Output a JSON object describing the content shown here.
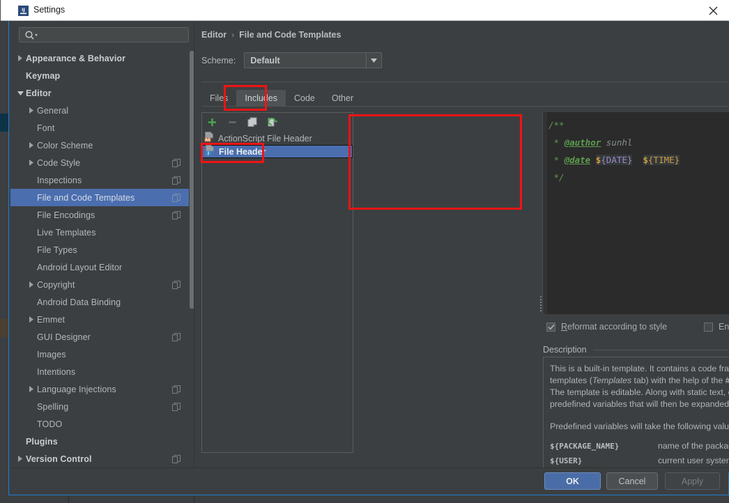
{
  "window": {
    "title": "Settings",
    "icon": "intellij-logo-icon",
    "close_label": "✕"
  },
  "sidebar": {
    "search": {
      "placeholder": "",
      "value": "",
      "icon": "search-icon"
    },
    "items": [
      {
        "label": "Appearance & Behavior",
        "arrow": "right",
        "indent": 0,
        "bold": true,
        "copy": false,
        "selected": false
      },
      {
        "label": "Keymap",
        "arrow": "none",
        "indent": 0,
        "bold": true,
        "copy": false,
        "selected": false
      },
      {
        "label": "Editor",
        "arrow": "down",
        "indent": 0,
        "bold": true,
        "copy": false,
        "selected": false
      },
      {
        "label": "General",
        "arrow": "right",
        "indent": 1,
        "bold": false,
        "copy": false,
        "selected": false
      },
      {
        "label": "Font",
        "arrow": "none",
        "indent": 1,
        "bold": false,
        "copy": false,
        "selected": false
      },
      {
        "label": "Color Scheme",
        "arrow": "right",
        "indent": 1,
        "bold": false,
        "copy": false,
        "selected": false
      },
      {
        "label": "Code Style",
        "arrow": "right",
        "indent": 1,
        "bold": false,
        "copy": true,
        "selected": false
      },
      {
        "label": "Inspections",
        "arrow": "none",
        "indent": 1,
        "bold": false,
        "copy": true,
        "selected": false
      },
      {
        "label": "File and Code Templates",
        "arrow": "none",
        "indent": 1,
        "bold": false,
        "copy": true,
        "selected": true
      },
      {
        "label": "File Encodings",
        "arrow": "none",
        "indent": 1,
        "bold": false,
        "copy": true,
        "selected": false
      },
      {
        "label": "Live Templates",
        "arrow": "none",
        "indent": 1,
        "bold": false,
        "copy": false,
        "selected": false
      },
      {
        "label": "File Types",
        "arrow": "none",
        "indent": 1,
        "bold": false,
        "copy": false,
        "selected": false
      },
      {
        "label": "Android Layout Editor",
        "arrow": "none",
        "indent": 1,
        "bold": false,
        "copy": false,
        "selected": false
      },
      {
        "label": "Copyright",
        "arrow": "right",
        "indent": 1,
        "bold": false,
        "copy": true,
        "selected": false
      },
      {
        "label": "Android Data Binding",
        "arrow": "none",
        "indent": 1,
        "bold": false,
        "copy": false,
        "selected": false
      },
      {
        "label": "Emmet",
        "arrow": "right",
        "indent": 1,
        "bold": false,
        "copy": false,
        "selected": false
      },
      {
        "label": "GUI Designer",
        "arrow": "none",
        "indent": 1,
        "bold": false,
        "copy": true,
        "selected": false
      },
      {
        "label": "Images",
        "arrow": "none",
        "indent": 1,
        "bold": false,
        "copy": false,
        "selected": false
      },
      {
        "label": "Intentions",
        "arrow": "none",
        "indent": 1,
        "bold": false,
        "copy": false,
        "selected": false
      },
      {
        "label": "Language Injections",
        "arrow": "right",
        "indent": 1,
        "bold": false,
        "copy": true,
        "selected": false
      },
      {
        "label": "Spelling",
        "arrow": "none",
        "indent": 1,
        "bold": false,
        "copy": true,
        "selected": false
      },
      {
        "label": "TODO",
        "arrow": "none",
        "indent": 1,
        "bold": false,
        "copy": false,
        "selected": false
      },
      {
        "label": "Plugins",
        "arrow": "none",
        "indent": 0,
        "bold": true,
        "copy": false,
        "selected": false
      },
      {
        "label": "Version Control",
        "arrow": "right",
        "indent": 0,
        "bold": true,
        "copy": true,
        "selected": false
      }
    ],
    "help_button": "?"
  },
  "breadcrumb": {
    "parent": "Editor",
    "separator": "›",
    "current": "File and Code Templates"
  },
  "scheme": {
    "label": "Scheme:",
    "value": "Default",
    "options": [
      "Default"
    ]
  },
  "tabs": [
    {
      "label": "Files",
      "active": false
    },
    {
      "label": "Includes",
      "active": true
    },
    {
      "label": "Code",
      "active": false
    },
    {
      "label": "Other",
      "active": false
    }
  ],
  "template_list": {
    "toolbar": [
      {
        "name": "add-template-button",
        "glyph": "+"
      },
      {
        "name": "remove-template-button",
        "glyph": "−"
      },
      {
        "name": "copy-template-button",
        "glyph": "copy"
      },
      {
        "name": "reset-template-button",
        "glyph": "reset"
      }
    ],
    "items": [
      {
        "label": "ActionScript File Header",
        "badge": "AS",
        "selected": false
      },
      {
        "label": "File Header",
        "badge": "J",
        "selected": true
      }
    ]
  },
  "editor": {
    "lines": [
      {
        "kind": "comment",
        "text": "/**"
      },
      {
        "kind": "author",
        "star": " * ",
        "tag": "@author",
        "value": " sunhl"
      },
      {
        "kind": "date",
        "star": " * ",
        "tag": "@date",
        "dollar1": "$",
        "var1": "{DATE}",
        "dollar2": "$",
        "var2": "{TIME}"
      },
      {
        "kind": "comment",
        "text": " */"
      }
    ]
  },
  "options": {
    "reformat": {
      "label": "Reformat according to style",
      "checked": true
    },
    "live_templates": {
      "label": "Enable Live Templates",
      "checked": false
    }
  },
  "description": {
    "legend": "Description",
    "paragraph1": "This is a built-in template. It contains a code fragment that can be included into file templates (Templates tab) with the help of the #parse directive.",
    "paragraph1_italic": "Templates",
    "paragraph1_bold": "#parse",
    "paragraph2": "The template is editable. Along with static text, code and comments, you can also use predefined variables that will then be expanded like macros into the corresponding values.",
    "paragraph3": "Predefined variables will take the following values:",
    "variables": [
      {
        "name": "${PACKAGE_NAME}",
        "meaning": "name of the package in which the new file is created"
      },
      {
        "name": "${USER}",
        "meaning": "current user system login name"
      }
    ]
  },
  "buttons": {
    "ok": "OK",
    "cancel": "Cancel",
    "apply": "Apply"
  },
  "colors": {
    "accent": "#4b6eaf",
    "annotation": "#f01414",
    "window_border": "#1d7dd4",
    "editor_bg": "#2b2b2b",
    "panel_bg": "#3c3f41"
  }
}
